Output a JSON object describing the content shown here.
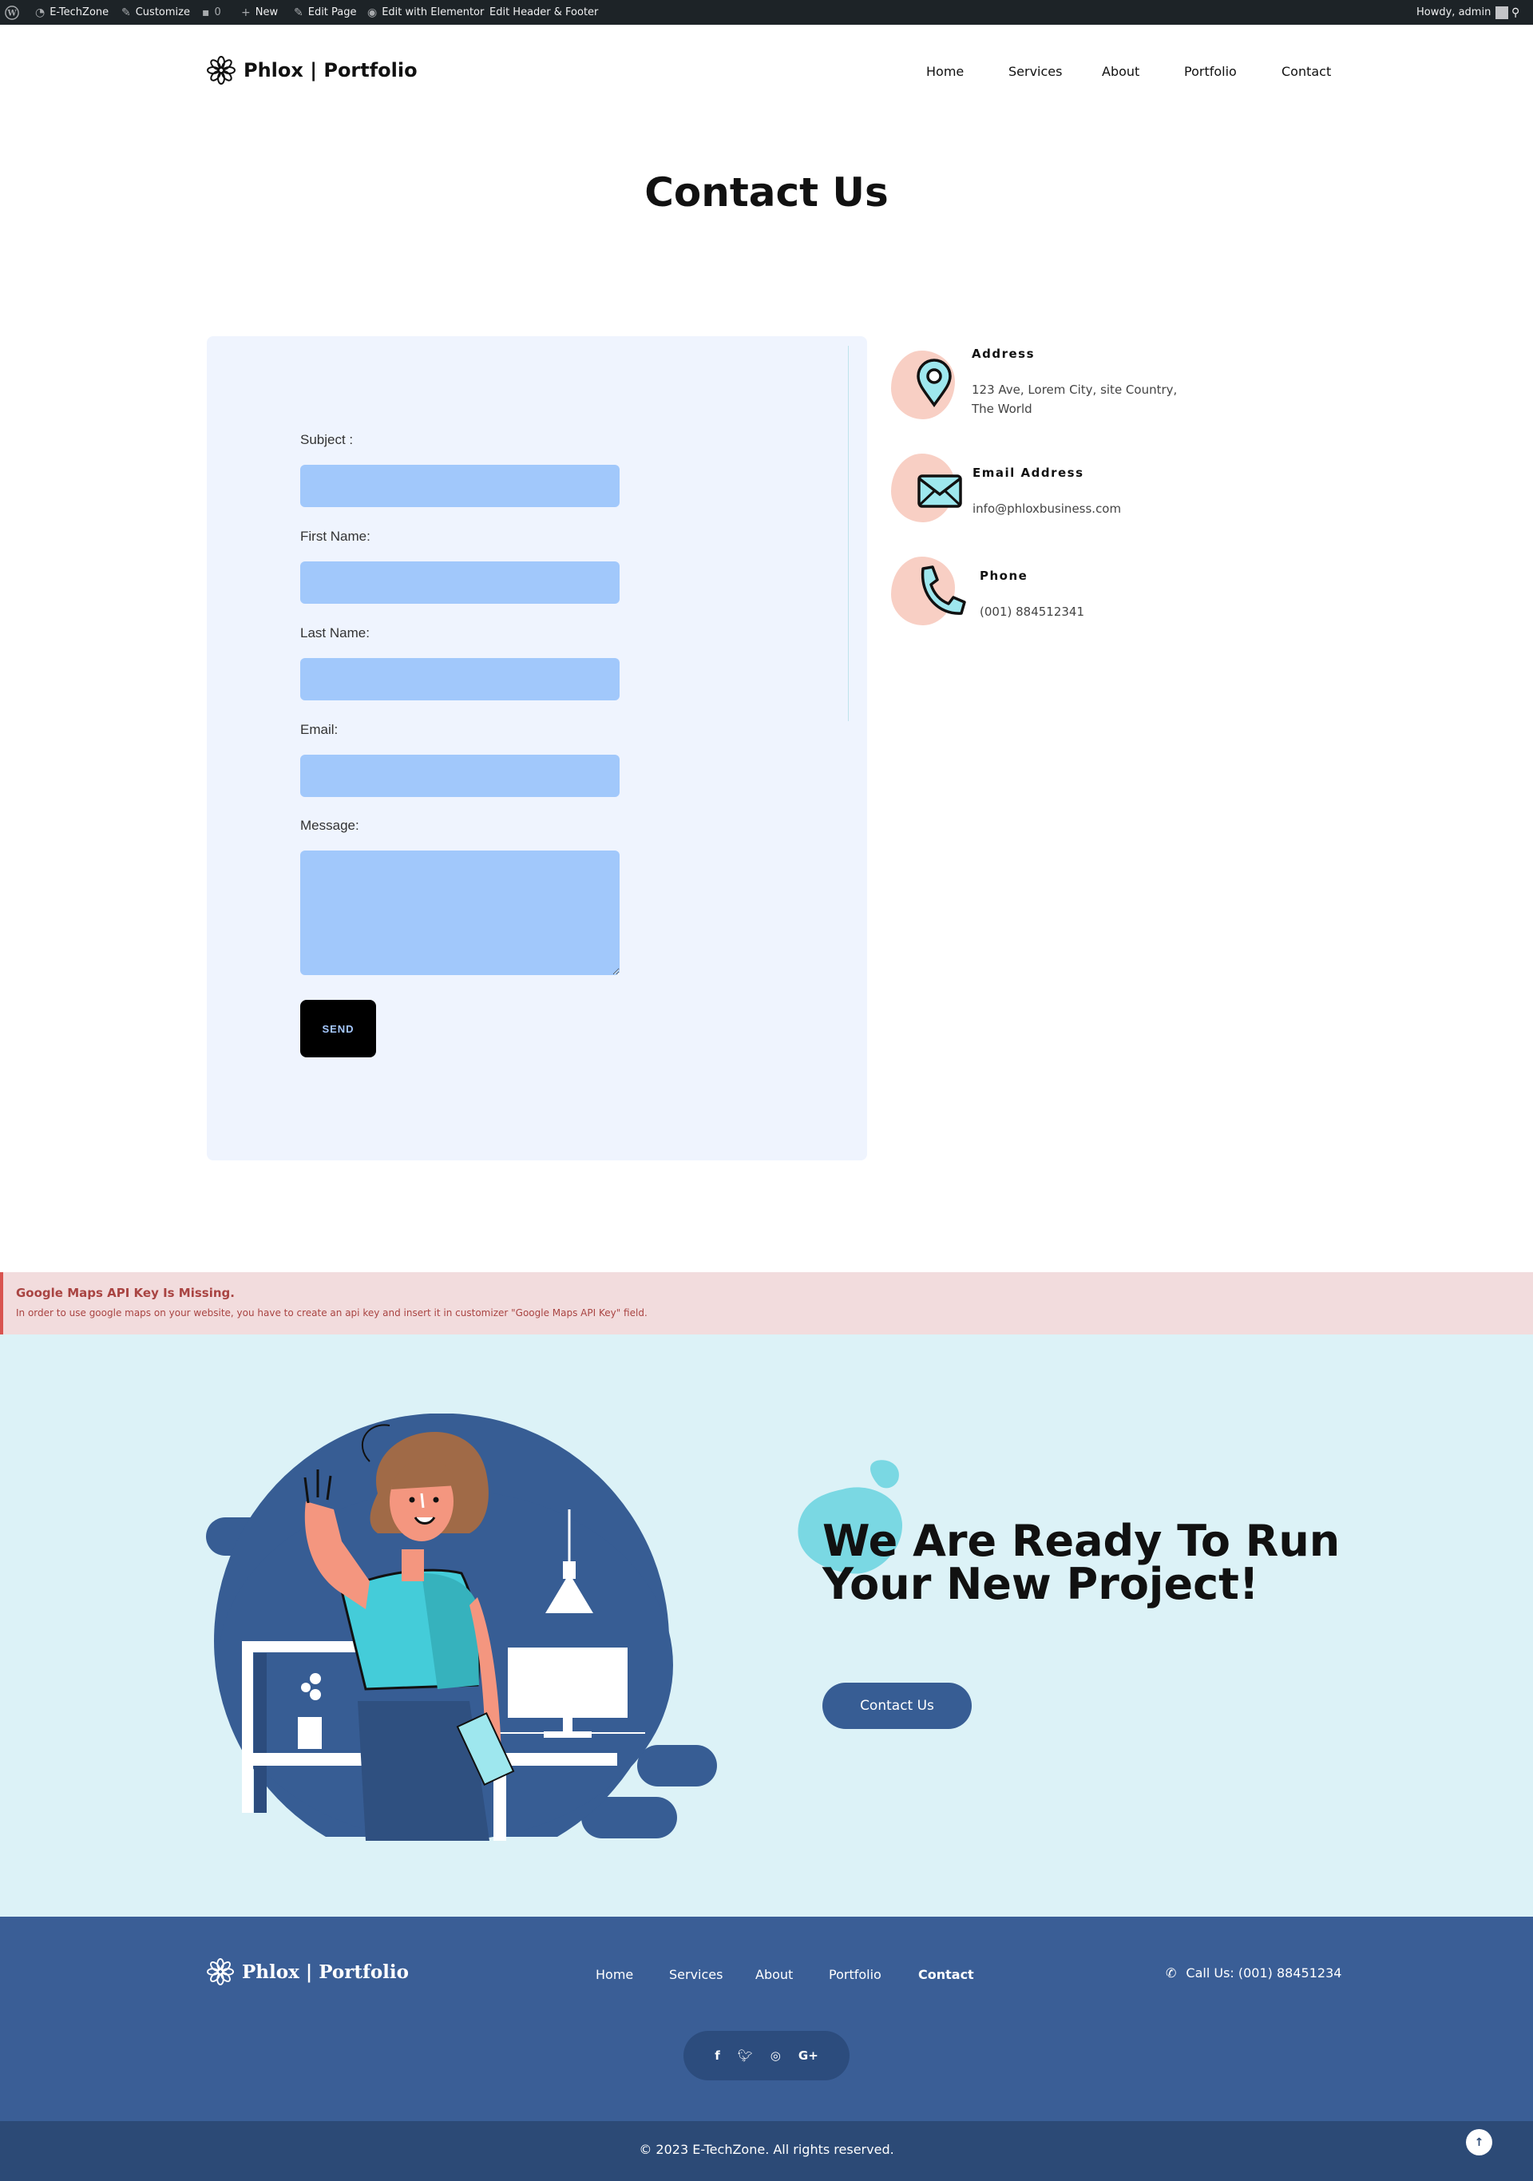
{
  "admin_bar": {
    "site": "E-TechZone",
    "customize": "Customize",
    "comments": "0",
    "new": "New",
    "edit_page": "Edit Page",
    "edit_elementor": "Edit with Elementor",
    "edit_header_footer": "Edit Header & Footer",
    "howdy": "Howdy, admin"
  },
  "header": {
    "logo_text": "Phlox | Portfolio",
    "nav": [
      "Home",
      "Services",
      "About",
      "Portfolio",
      "Contact"
    ]
  },
  "page_title": "Contact Us",
  "form": {
    "subject_label": "Subject :",
    "first_name_label": "First Name:",
    "last_name_label": "Last Name:",
    "email_label": "Email:",
    "message_label": "Message:",
    "send_label": "SEND"
  },
  "contact_info": {
    "address_title": "Address",
    "address_line1": "123 Ave, Lorem City, site Country,",
    "address_line2": "The World",
    "email_title": "Email Address",
    "email_value": "info@phloxbusiness.com",
    "phone_title": "Phone",
    "phone_value": "(001) 884512341"
  },
  "map_error": {
    "title": "Google Maps API Key Is Missing.",
    "message": "In order to use google maps on your website, you have to create an api key and insert it in customizer \"Google Maps API Key\" field."
  },
  "cta": {
    "title_line1": "We Are Ready To Run",
    "title_line2": "Your New Project!",
    "button": "Contact Us"
  },
  "footer": {
    "logo_text": "Phlox | Portfolio",
    "nav": [
      "Home",
      "Services",
      "About",
      "Portfolio",
      "Contact"
    ],
    "call": "Call Us: (001) 88451234",
    "social": [
      "facebook-icon",
      "twitter-icon",
      "instagram-icon",
      "google-plus-icon"
    ],
    "copyright": "© 2023 E-TechZone. All rights reserved."
  },
  "colors": {
    "admin_bar": "#1d2327",
    "form_card": "#eff4fe",
    "input_fill": "#a1c8fb",
    "cta_bg": "#dcf2f7",
    "footer_bg": "#3a5e96",
    "accent_blue": "#375d94",
    "teal": "#44ccd9",
    "salmon": "#f8cfc4"
  }
}
